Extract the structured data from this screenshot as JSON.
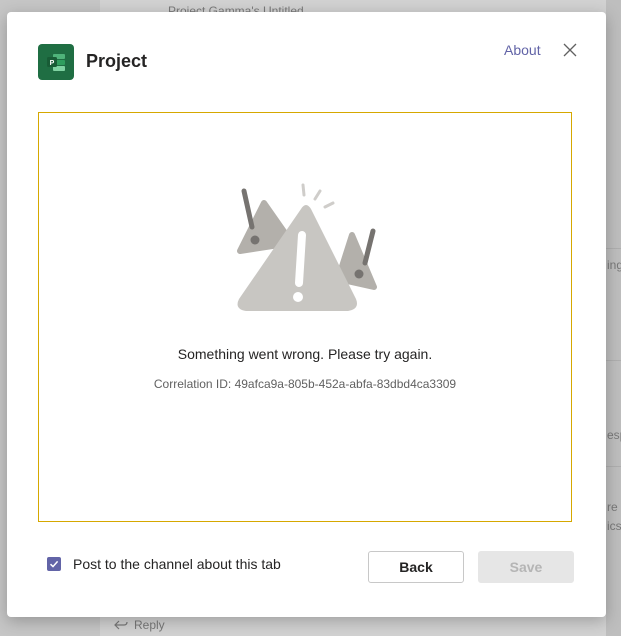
{
  "background": {
    "top_text": "Project Gamma's Untitled",
    "side_texts": [
      "ing",
      "esp",
      "re s",
      "ics"
    ],
    "reply_label": "Reply"
  },
  "dialog": {
    "app_name": "Project",
    "app_icon_letter": "P",
    "about_label": "About",
    "error": {
      "message": "Something went wrong. Please try again.",
      "correlation_id": "Correlation ID: 49afca9a-805b-452a-abfa-83dbd4ca3309"
    },
    "post_to_channel": {
      "label": "Post to the channel about this tab",
      "checked": true
    },
    "back_label": "Back",
    "save_label": "Save"
  },
  "colors": {
    "brand": "#6264a7",
    "project_green": "#1f6e43",
    "frame_border": "#d6a800"
  }
}
